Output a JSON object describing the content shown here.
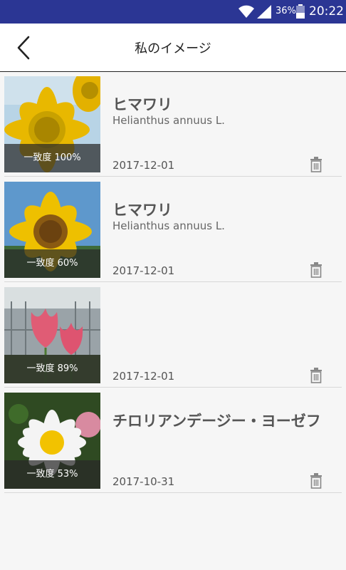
{
  "status": {
    "battery": "36%",
    "time": "20:22"
  },
  "header": {
    "title": "私のイメージ"
  },
  "items": [
    {
      "name": "ヒマワリ",
      "scientific": "Helianthus annuus L.",
      "match": "一致度 100%",
      "date": "2017-12-01"
    },
    {
      "name": "ヒマワリ",
      "scientific": "Helianthus annuus L.",
      "match": "一致度 60%",
      "date": "2017-12-01"
    },
    {
      "name": "",
      "scientific": "",
      "match": "一致度 89%",
      "date": "2017-12-01"
    },
    {
      "name": "チロリアンデージー・ヨーゼフ",
      "scientific": "",
      "match": "一致度 53%",
      "date": "2017-10-31"
    }
  ]
}
